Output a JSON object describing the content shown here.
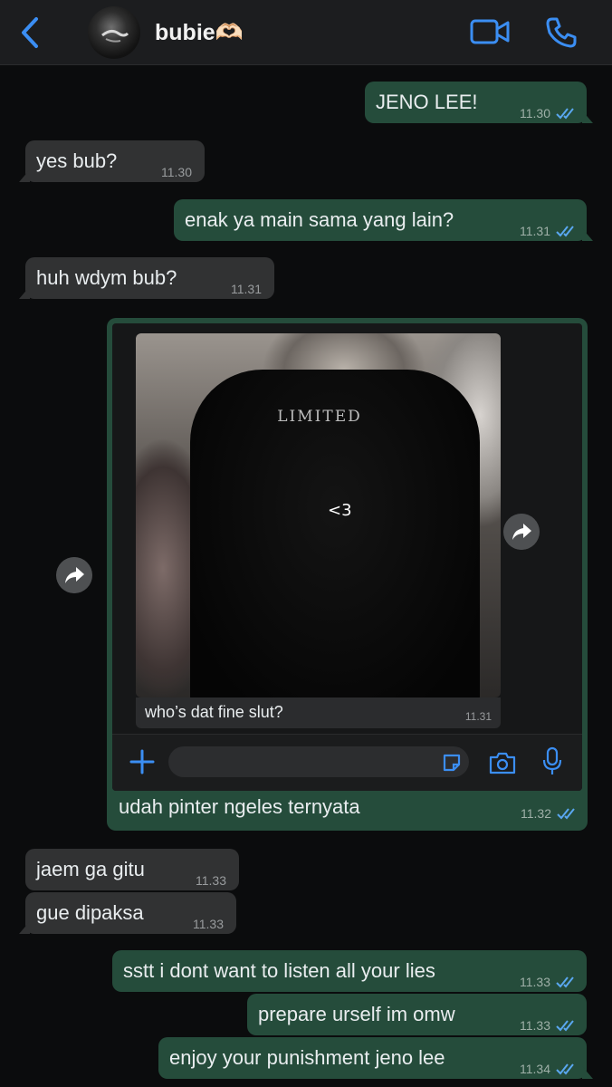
{
  "header": {
    "contact_name": "bubie🫶🏻"
  },
  "colors": {
    "accent": "#3b8ef3",
    "outgoing_bubble": "#254c3b",
    "incoming_bubble": "#313233",
    "read_ticks": "#5aa7f0"
  },
  "messages": [
    {
      "text": "JENO LEE!",
      "time": "11.30"
    },
    {
      "text": "yes bub?",
      "time": "11.30"
    },
    {
      "text": "enak ya main sama yang lain?",
      "time": "11.31"
    },
    {
      "text": "huh wdym bub?",
      "time": "11.31"
    },
    {
      "text": "jaem ga gitu",
      "time": "11.33"
    },
    {
      "text": "gue dipaksa",
      "time": "11.33"
    },
    {
      "text": "sstt i dont want to listen all your lies",
      "time": "11.33"
    },
    {
      "text": "prepare urself im omw",
      "time": "11.33"
    },
    {
      "text": "enjoy your punishment jeno lee",
      "time": "11.34"
    }
  ],
  "media_message": {
    "photo_text": "<3",
    "shirt_print": "LIMITED",
    "caption": "who’s dat fine slut?",
    "caption_time": "11.31",
    "text": "udah pinter ngeles ternyata",
    "time": "11.32"
  },
  "composer": {
    "placeholder": ""
  },
  "icons": {
    "back": "chevron-left-icon",
    "video": "video-camera-icon",
    "call": "phone-icon",
    "forward": "forward-arrow-icon",
    "plus": "plus-icon",
    "sticker": "sticker-icon",
    "camera": "camera-icon",
    "mic": "microphone-icon",
    "ticks": "double-check-icon"
  }
}
